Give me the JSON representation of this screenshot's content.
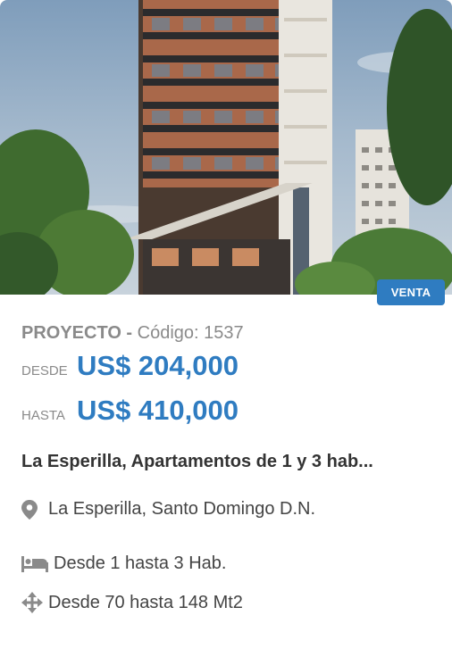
{
  "listing": {
    "badge": "VENTA",
    "type": "PROYECTO",
    "separator": " - ",
    "code_label": "Código: 1537",
    "price_from_label": "DESDE",
    "price_from": "US$ 204,000",
    "price_to_label": "HASTA",
    "price_to": "US$ 410,000",
    "title": "La Esperilla, Apartamentos de 1 y 3 hab...",
    "location": "La Esperilla, Santo Domingo D.N.",
    "bedrooms": "Desde 1 hasta 3 Hab.",
    "area": "Desde 70 hasta 148 Mt2"
  },
  "colors": {
    "accent": "#2f7cc1",
    "muted": "#8a8a8a",
    "text": "#333333"
  },
  "icons": [
    "map-marker-icon",
    "bed-icon",
    "arrows-move-icon"
  ]
}
